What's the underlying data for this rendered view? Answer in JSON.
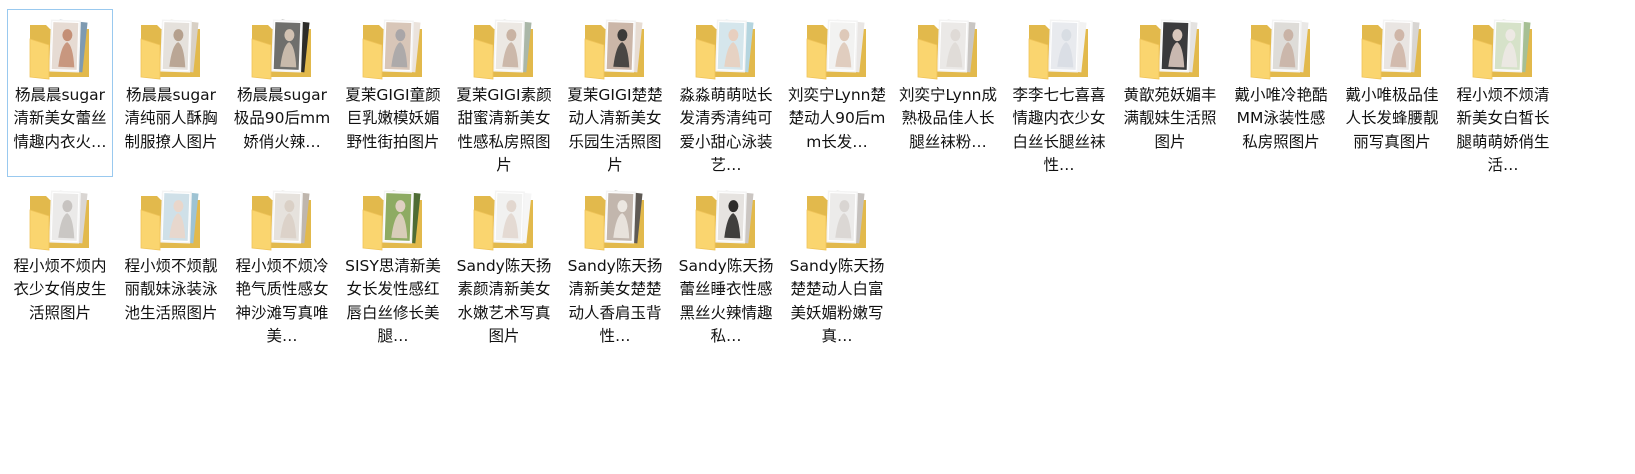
{
  "colors": {
    "folder_back": "#e2b94c",
    "folder_front": "#fad56f",
    "folder_front_edge": "#f0c45a",
    "selection_border": "#99c9ef"
  },
  "folders": [
    {
      "label": "杨晨晨sugar清新美女蕾丝情趣内衣火…",
      "selected": true,
      "photos": [
        [
          "#e6dbd3",
          "#c48f76",
          "#7e9ab1"
        ]
      ]
    },
    {
      "label": "杨晨晨sugar清纯丽人酥胸制服撩人图片",
      "photos": [
        [
          "#e5e1dc",
          "#b5a08d",
          "#d8d0c5"
        ]
      ]
    },
    {
      "label": "杨晨晨sugar极品90后mm娇俏火辣…",
      "photos": [
        [
          "#6f6f6c",
          "#d2c2b2",
          "#2d2c29"
        ]
      ]
    },
    {
      "label": "夏茉GIGI童颜巨乳嫩模妖媚野性街拍图片",
      "photos": [
        [
          "#d8c6b8",
          "#a9a6a8",
          "#ebe3dc"
        ]
      ]
    },
    {
      "label": "夏茉GIGI素颜甜蜜清新美女性感私房照图片",
      "photos": [
        [
          "#ece8e3",
          "#c9b3a3",
          "#aab7a8"
        ]
      ]
    },
    {
      "label": "夏茉GIGI楚楚动人清新美女乐园生活照图片",
      "photos": [
        [
          "#cbb6a8",
          "#3b3a39",
          "#e7dcd2"
        ]
      ]
    },
    {
      "label": "淼淼萌萌哒长发清秀清纯可爱小甜心泳装艺…",
      "photos": [
        [
          "#d5e6ec",
          "#e8cfbf",
          "#b5d5df"
        ]
      ]
    },
    {
      "label": "刘奕宁Lynn楚楚动人90后mm长发…",
      "photos": [
        [
          "#f2f2f1",
          "#dec9b9",
          "#e9e6e4"
        ]
      ]
    },
    {
      "label": "刘奕宁Lynn成熟极品佳人长腿丝袜粉…",
      "photos": [
        [
          "#ebe9e7",
          "#dfdad6",
          "#c9c6c3"
        ]
      ]
    },
    {
      "label": "李李七七喜喜情趣内衣少女白丝长腿丝袜性…",
      "photos": [
        [
          "#e8eaee",
          "#d8dde3",
          "#f2f2f2"
        ]
      ]
    },
    {
      "label": "黄歆苑妖媚丰满靓妹生活照图片",
      "photos": [
        [
          "#3a3a3c",
          "#d9c7bc",
          "#e4e2e0"
        ]
      ]
    },
    {
      "label": "戴小唯冷艳酷MM泳装性感私房照图片",
      "photos": [
        [
          "#dedcd8",
          "#c9b3a6",
          "#eae8e6"
        ]
      ]
    },
    {
      "label": "戴小唯极品佳人长发蜂腰靓丽写真图片",
      "photos": [
        [
          "#e9e5e2",
          "#cfb6a8",
          "#d8d5d2"
        ]
      ]
    },
    {
      "label": "程小烦不烦清新美女白皙长腿萌萌娇俏生活…",
      "photos": [
        [
          "#d6e2c9",
          "#ede9e4",
          "#a6bf94"
        ]
      ]
    },
    {
      "label": "程小烦不烦内衣少女俏皮生活照图片",
      "photos": [
        [
          "#ebeae9",
          "#c7c3c0",
          "#dad6d3"
        ]
      ]
    },
    {
      "label": "程小烦不烦靓丽靓妹泳装泳池生活照图片",
      "photos": [
        [
          "#cfe0e8",
          "#e9d6ca",
          "#9ec3d3"
        ]
      ]
    },
    {
      "label": "程小烦不烦冷艳气质性感女神沙滩写真唯美…",
      "photos": [
        [
          "#e6e2dd",
          "#dad0c6",
          "#bfb6ad"
        ]
      ]
    },
    {
      "label": "SISY思清新美女长发性感红唇白丝修长美腿…",
      "photos": [
        [
          "#8eab63",
          "#e0d0c2",
          "#4e6c34"
        ]
      ]
    },
    {
      "label": "Sandy陈天扬素颜清新美女水嫩艺术写真图片",
      "photos": [
        [
          "#f1f1f0",
          "#e2d7cf",
          "#f6f6f6"
        ]
      ]
    },
    {
      "label": "Sandy陈天扬清新美女楚楚动人香肩玉背性…",
      "photos": [
        [
          "#c2b6ad",
          "#ece7e1",
          "#5f5a55"
        ]
      ]
    },
    {
      "label": "Sandy陈天扬蕾丝睡衣性感黑丝火辣情趣私…",
      "photos": [
        [
          "#e6e3e0",
          "#2e2c2b",
          "#cbc6c2"
        ]
      ]
    },
    {
      "label": "Sandy陈天扬楚楚动人白富美妖媚粉嫩写真…",
      "photos": [
        [
          "#ecebea",
          "#d9d5d2",
          "#c5c1be"
        ]
      ]
    }
  ]
}
